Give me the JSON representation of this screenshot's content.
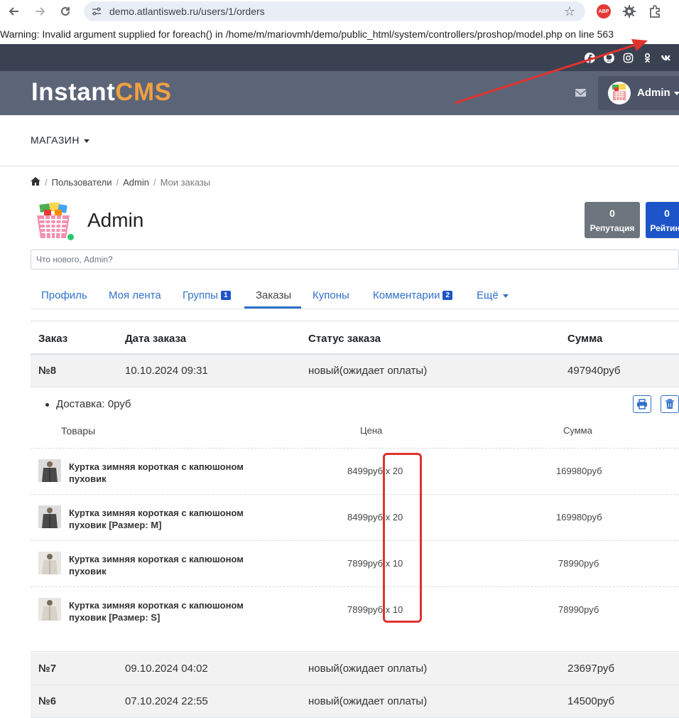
{
  "browser": {
    "url": "demo.atlantisweb.ru/users/1/orders",
    "extension_label": "ABP"
  },
  "warning": "Warning: Invalid argument supplied for foreach() in /home/m/mariovmh/demo/public_html/system/controllers/proshop/model.php on line 563",
  "social_icons": [
    "facebook-icon",
    "github-icon",
    "instagram-icon",
    "odnoklassniki-icon",
    "vk-icon"
  ],
  "header": {
    "logo_main": "Instant",
    "logo_accent": "CMS",
    "user_name": "Admin"
  },
  "menu": {
    "shop": "МАГАЗИН"
  },
  "breadcrumb": {
    "users": "Пользователи",
    "admin": "Admin",
    "current": "Мои заказы",
    "separator": "/"
  },
  "profile": {
    "name": "Admin",
    "reputation_value": "0",
    "reputation_label": "Репутация",
    "rating_value": "0",
    "rating_label": "Рейтинг"
  },
  "whatsnew_placeholder": "Что нового, Admin?",
  "tabs": [
    {
      "label": "Профиль"
    },
    {
      "label": "Моя лента"
    },
    {
      "label": "Группы",
      "badge": "1"
    },
    {
      "label": "Заказы"
    },
    {
      "label": "Купоны"
    },
    {
      "label": "Комментарии",
      "badge": "2"
    },
    {
      "label": "Ещё"
    }
  ],
  "table": {
    "headers": [
      "Заказ",
      "Дата заказа",
      "Статус заказа",
      "Сумма"
    ],
    "orders": [
      {
        "num": "№8",
        "date": "10.10.2024 09:31",
        "status": "новый(ожидает оплаты)",
        "sum": "497940руб"
      },
      {
        "num": "№7",
        "date": "09.10.2024 04:02",
        "status": "новый(ожидает оплаты)",
        "sum": "23697руб"
      },
      {
        "num": "№6",
        "date": "07.10.2024 22:55",
        "status": "новый(ожидает оплаты)",
        "sum": "14500руб"
      }
    ]
  },
  "details": {
    "delivery": "Доставка: 0руб",
    "headers": {
      "goods": "Товары",
      "price": "Цена",
      "sum": "Сумма"
    },
    "items": [
      {
        "name": "Куртка зимняя короткая с капюшоном пуховик",
        "price": "8499руб x 20",
        "sum": "169980руб"
      },
      {
        "name": "Куртка зимняя короткая с капюшоном пуховик [Размер: M]",
        "price": "8499руб x 20",
        "sum": "169980руб"
      },
      {
        "name": "Куртка зимняя короткая с капюшоном пуховик",
        "price": "7899руб x 10",
        "sum": "78990руб"
      },
      {
        "name": "Куртка зимняя короткая с капюшоном пуховик [Размер: S]",
        "price": "7899руб x 10",
        "sum": "78990руб"
      }
    ]
  },
  "colors": {
    "accent": "#3071c9",
    "logo_accent": "#f0a043",
    "header_bg": "#5c6478",
    "annotation_red": "#e0332e"
  }
}
